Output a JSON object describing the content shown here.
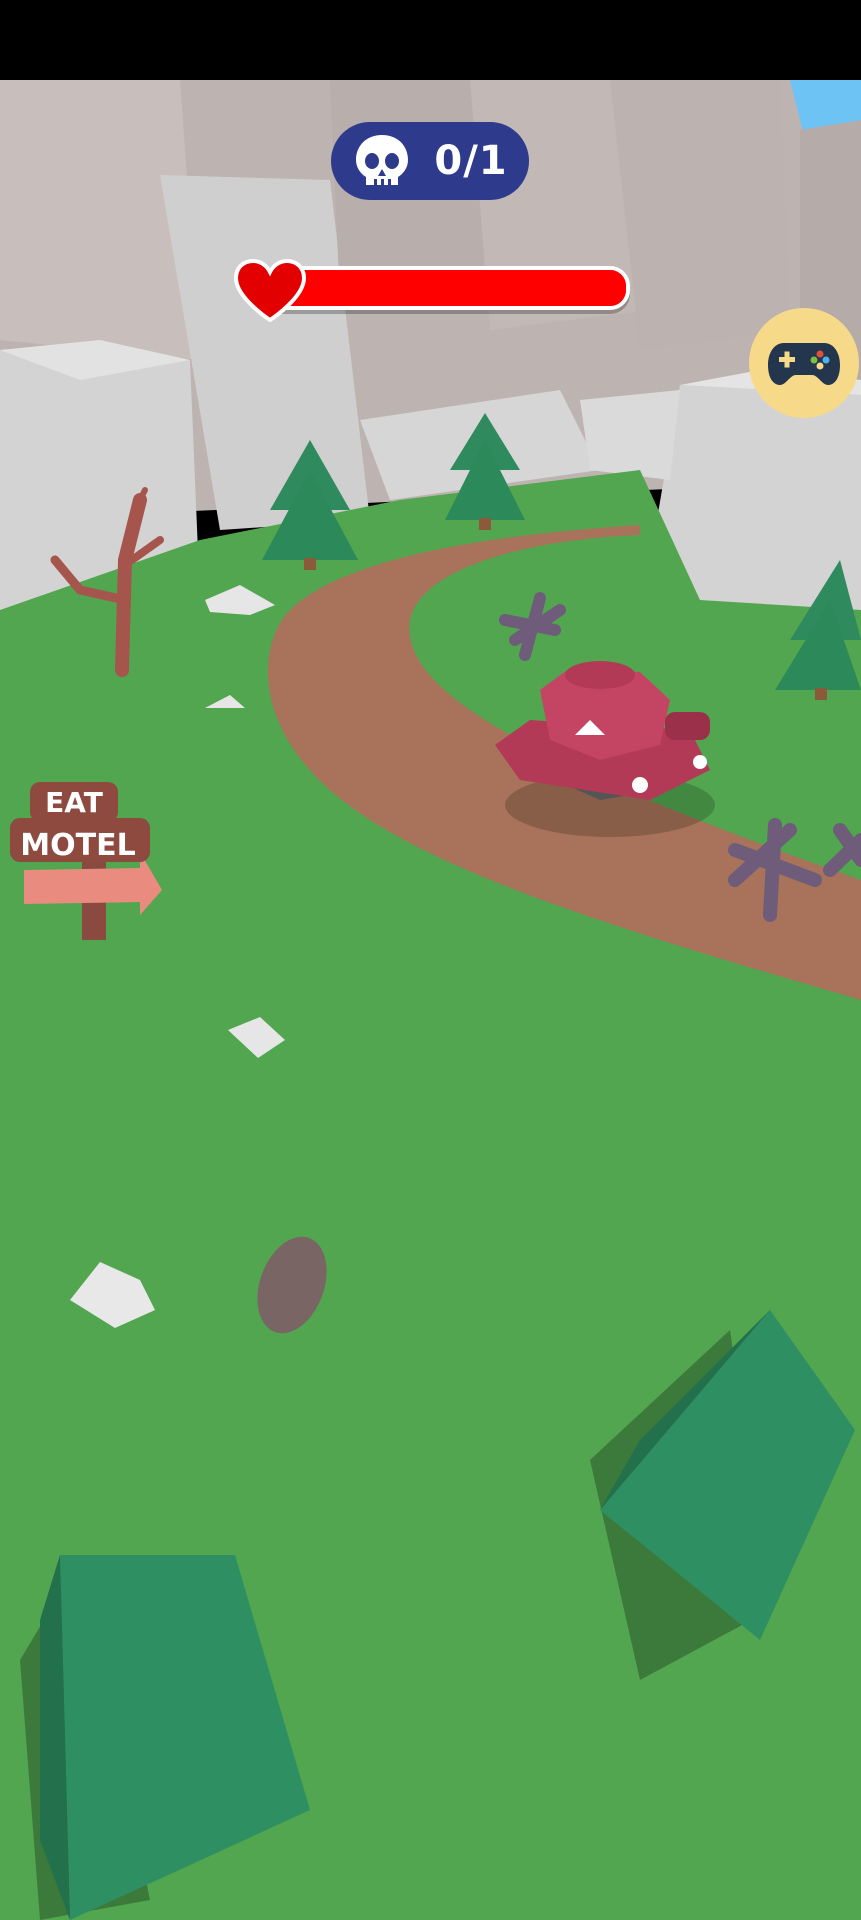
{
  "hud": {
    "kill_counter": {
      "icon": "skull-icon",
      "text": "0/1",
      "background": "#2e3a8c"
    },
    "health": {
      "icon": "heart-icon",
      "fraction": 1.0,
      "color": "#ff0000"
    },
    "gamepad_button": {
      "icon": "gamepad-icon",
      "background": "#f7d98a"
    }
  },
  "scene": {
    "sign": {
      "top_text": "EAT",
      "bottom_text": "MOTEL"
    },
    "colors": {
      "grass": "#52a650",
      "road": "#a8735a",
      "rock": "#c9c9c9",
      "tree": "#2f8f66",
      "tank": "#b23a57",
      "sky": "#6ec3f5"
    }
  }
}
